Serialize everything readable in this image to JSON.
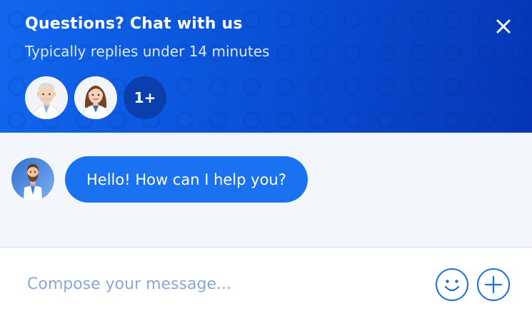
{
  "header": {
    "title": "Questions? Chat with us",
    "subtitle": "Typically replies under 14 minutes",
    "more_agents_label": "1+",
    "close_icon": "close-icon",
    "accent_color": "#1167ee"
  },
  "agents": [
    {
      "avatar": "doctor-male-avatar"
    },
    {
      "avatar": "doctor-female-avatar"
    }
  ],
  "conversation": {
    "messages": [
      {
        "sender_avatar": "bearded-doctor-avatar",
        "text": "Hello! How can I help you?"
      }
    ],
    "bubble_color": "#1b72f0"
  },
  "composer": {
    "placeholder": "Compose your message...",
    "value": "",
    "emoji_icon": "smiley-icon",
    "add_icon": "plus-circle-icon"
  }
}
